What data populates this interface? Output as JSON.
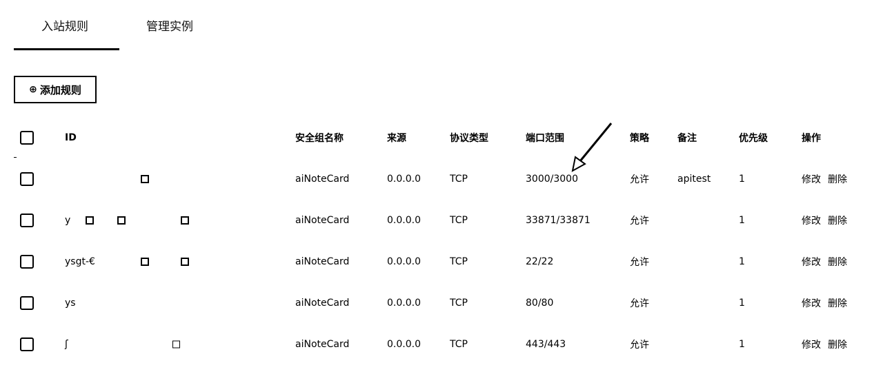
{
  "tabs": [
    {
      "label": "入站规则",
      "active": true
    },
    {
      "label": "管理实例",
      "active": false
    }
  ],
  "toolbar": {
    "add_rule_label": "添加规则",
    "add_icon": "plus-circle-icon"
  },
  "table": {
    "headers": {
      "id": "ID",
      "name": "安全组名称",
      "source": "来源",
      "protocol": "协议类型",
      "port": "端口范围",
      "policy": "策略",
      "note": "备注",
      "priority": "优先级",
      "action": "操作"
    },
    "rows": [
      {
        "id": "",
        "name": "aiNoteCard",
        "source": "0.0.0.0",
        "protocol": "TCP",
        "port": "3000/3000",
        "policy": "允许",
        "note": "apitest",
        "priority": "1",
        "edit": "修改",
        "delete": "删除"
      },
      {
        "id": "y",
        "name": "aiNoteCard",
        "source": "0.0.0.0",
        "protocol": "TCP",
        "port": "33871/33871",
        "policy": "允许",
        "note": "",
        "priority": "1",
        "edit": "修改",
        "delete": "删除"
      },
      {
        "id": "ysgt-€",
        "name": "aiNoteCard",
        "source": "0.0.0.0",
        "protocol": "TCP",
        "port": "22/22",
        "policy": "允许",
        "note": "",
        "priority": "1",
        "edit": "修改",
        "delete": "删除"
      },
      {
        "id": "ys",
        "name": "aiNoteCard",
        "source": "0.0.0.0",
        "protocol": "TCP",
        "port": "80/80",
        "policy": "允许",
        "note": "",
        "priority": "1",
        "edit": "修改",
        "delete": "删除"
      },
      {
        "id": "ʃ",
        "name": "aiNoteCard",
        "source": "0.0.0.0",
        "protocol": "TCP",
        "port": "443/443",
        "policy": "允许",
        "note": "",
        "priority": "1",
        "edit": "修改",
        "delete": "删除"
      }
    ]
  }
}
